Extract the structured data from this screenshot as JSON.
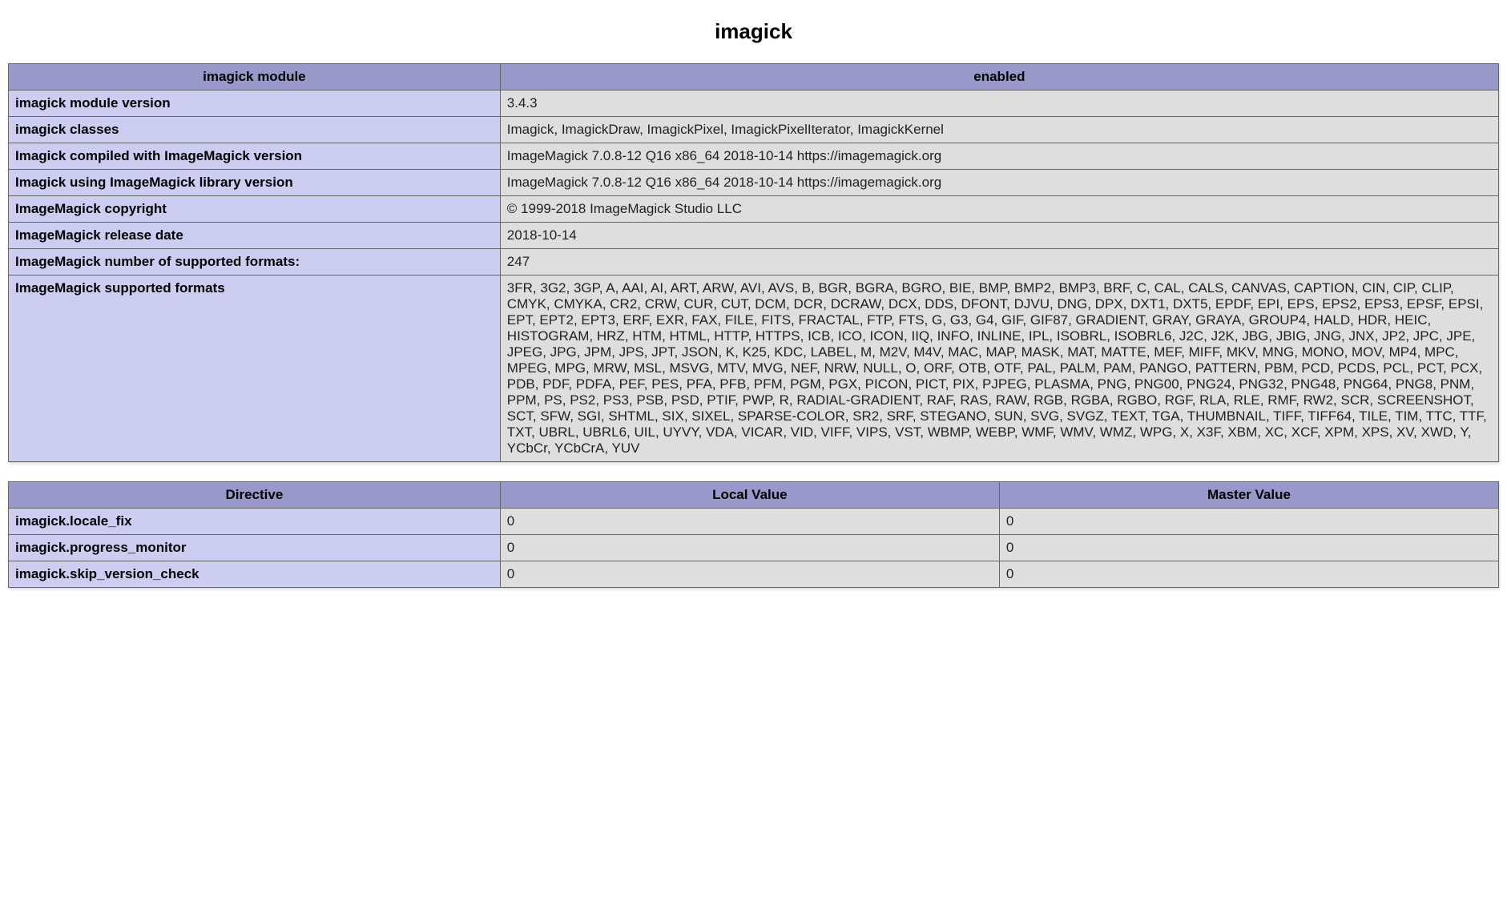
{
  "title": "imagick",
  "info_table": {
    "header_left": "imagick module",
    "header_right": "enabled",
    "rows": [
      {
        "k": "imagick module version",
        "v": "3.4.3"
      },
      {
        "k": "imagick classes",
        "v": "Imagick, ImagickDraw, ImagickPixel, ImagickPixelIterator, ImagickKernel"
      },
      {
        "k": "Imagick compiled with ImageMagick version",
        "v": "ImageMagick 7.0.8-12 Q16 x86_64 2018-10-14 https://imagemagick.org"
      },
      {
        "k": "Imagick using ImageMagick library version",
        "v": "ImageMagick 7.0.8-12 Q16 x86_64 2018-10-14 https://imagemagick.org"
      },
      {
        "k": "ImageMagick copyright",
        "v": "© 1999-2018 ImageMagick Studio LLC"
      },
      {
        "k": "ImageMagick release date",
        "v": "2018-10-14"
      },
      {
        "k": "ImageMagick number of supported formats:",
        "v": "247"
      },
      {
        "k": "ImageMagick supported formats",
        "v": "3FR, 3G2, 3GP, A, AAI, AI, ART, ARW, AVI, AVS, B, BGR, BGRA, BGRO, BIE, BMP, BMP2, BMP3, BRF, C, CAL, CALS, CANVAS, CAPTION, CIN, CIP, CLIP, CMYK, CMYKA, CR2, CRW, CUR, CUT, DCM, DCR, DCRAW, DCX, DDS, DFONT, DJVU, DNG, DPX, DXT1, DXT5, EPDF, EPI, EPS, EPS2, EPS3, EPSF, EPSI, EPT, EPT2, EPT3, ERF, EXR, FAX, FILE, FITS, FRACTAL, FTP, FTS, G, G3, G4, GIF, GIF87, GRADIENT, GRAY, GRAYA, GROUP4, HALD, HDR, HEIC, HISTOGRAM, HRZ, HTM, HTML, HTTP, HTTPS, ICB, ICO, ICON, IIQ, INFO, INLINE, IPL, ISOBRL, ISOBRL6, J2C, J2K, JBG, JBIG, JNG, JNX, JP2, JPC, JPE, JPEG, JPG, JPM, JPS, JPT, JSON, K, K25, KDC, LABEL, M, M2V, M4V, MAC, MAP, MASK, MAT, MATTE, MEF, MIFF, MKV, MNG, MONO, MOV, MP4, MPC, MPEG, MPG, MRW, MSL, MSVG, MTV, MVG, NEF, NRW, NULL, O, ORF, OTB, OTF, PAL, PALM, PAM, PANGO, PATTERN, PBM, PCD, PCDS, PCL, PCT, PCX, PDB, PDF, PDFA, PEF, PES, PFA, PFB, PFM, PGM, PGX, PICON, PICT, PIX, PJPEG, PLASMA, PNG, PNG00, PNG24, PNG32, PNG48, PNG64, PNG8, PNM, PPM, PS, PS2, PS3, PSB, PSD, PTIF, PWP, R, RADIAL-GRADIENT, RAF, RAS, RAW, RGB, RGBA, RGBO, RGF, RLA, RLE, RMF, RW2, SCR, SCREENSHOT, SCT, SFW, SGI, SHTML, SIX, SIXEL, SPARSE-COLOR, SR2, SRF, STEGANO, SUN, SVG, SVGZ, TEXT, TGA, THUMBNAIL, TIFF, TIFF64, TILE, TIM, TTC, TTF, TXT, UBRL, UBRL6, UIL, UYVY, VDA, VICAR, VID, VIFF, VIPS, VST, WBMP, WEBP, WMF, WMV, WMZ, WPG, X, X3F, XBM, XC, XCF, XPM, XPS, XV, XWD, Y, YCbCr, YCbCrA, YUV"
      }
    ]
  },
  "dir_table": {
    "headers": [
      "Directive",
      "Local Value",
      "Master Value"
    ],
    "rows": [
      {
        "k": "imagick.locale_fix",
        "local": "0",
        "master": "0"
      },
      {
        "k": "imagick.progress_monitor",
        "local": "0",
        "master": "0"
      },
      {
        "k": "imagick.skip_version_check",
        "local": "0",
        "master": "0"
      }
    ]
  }
}
